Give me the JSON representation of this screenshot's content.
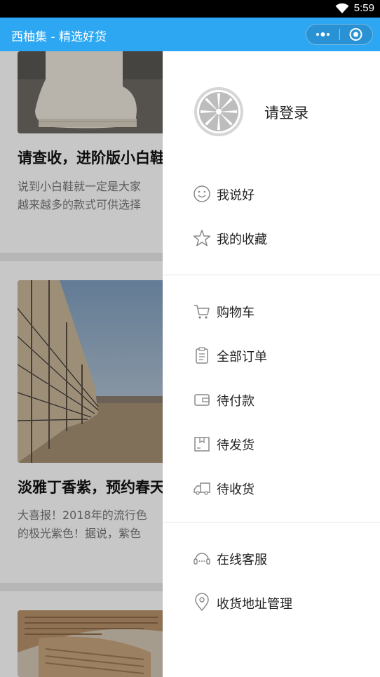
{
  "status_bar": {
    "time": "5:59"
  },
  "nav": {
    "title": "西柚集 - 精选好货"
  },
  "articles": [
    {
      "title": "请查收，进阶版小白鞋",
      "desc_line1": "说到小白鞋就一定是大家",
      "desc_line2": "越来越多的款式可供选择"
    },
    {
      "title": "淡雅丁香紫，预约春天",
      "desc_line1": "大喜报！2018年的流行色",
      "desc_line2": "的极光紫色！据说，紫色"
    }
  ],
  "drawer": {
    "login_label": "请登录",
    "group1": [
      {
        "label": "我说好",
        "icon": "smile-icon"
      },
      {
        "label": "我的收藏",
        "icon": "star-icon"
      }
    ],
    "group2": [
      {
        "label": "购物车",
        "icon": "cart-icon"
      },
      {
        "label": "全部订单",
        "icon": "clipboard-icon"
      },
      {
        "label": "待付款",
        "icon": "wallet-icon"
      },
      {
        "label": "待发货",
        "icon": "package-icon"
      },
      {
        "label": "待收货",
        "icon": "truck-icon"
      }
    ],
    "group3": [
      {
        "label": "在线客服",
        "icon": "headset-icon"
      },
      {
        "label": "收货地址管理",
        "icon": "location-pin-icon"
      }
    ]
  },
  "colors": {
    "nav_bg": "#2ea7f2",
    "text": "#222222"
  }
}
